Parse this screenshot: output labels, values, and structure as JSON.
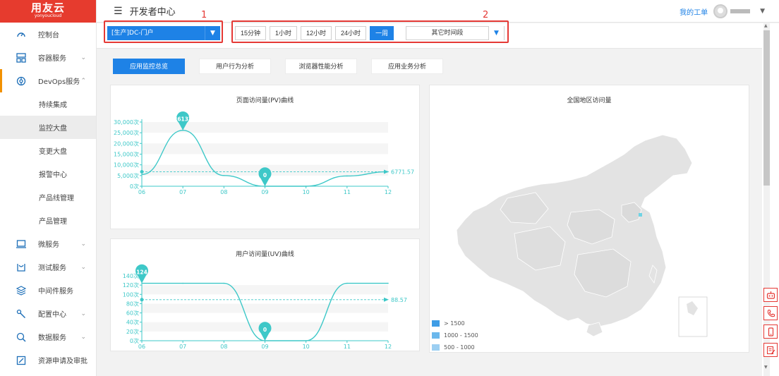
{
  "sidebar": {
    "logo": {
      "brand": "用友云",
      "sub": "yonyoucloud"
    },
    "items": [
      {
        "label": "控制台",
        "icon": "dashboard-icon"
      },
      {
        "label": "容器服务",
        "icon": "container-icon",
        "caret": "⌄"
      },
      {
        "label": "DevOps服务",
        "icon": "devops-icon",
        "caret": "⌃"
      },
      {
        "label": "持续集成"
      },
      {
        "label": "监控大盘"
      },
      {
        "label": "变更大盘"
      },
      {
        "label": "报警中心"
      },
      {
        "label": "产品线管理"
      },
      {
        "label": "产品管理"
      },
      {
        "label": "微服务",
        "icon": "microservice-icon",
        "caret": "⌄"
      },
      {
        "label": "测试服务",
        "icon": "test-icon",
        "caret": "⌄"
      },
      {
        "label": "中间件服务",
        "icon": "middleware-icon"
      },
      {
        "label": "配置中心",
        "icon": "config-icon",
        "caret": "⌄"
      },
      {
        "label": "数据服务",
        "icon": "data-icon",
        "caret": "⌄"
      },
      {
        "label": "资源申请及审批",
        "icon": "resource-icon"
      }
    ]
  },
  "header": {
    "title": "开发者中心",
    "work_order": "我的工单"
  },
  "filter": {
    "env_select": "[生产]DC-门户",
    "time_buttons": [
      "15分钟",
      "1小时",
      "12小时",
      "24小时",
      "一周"
    ],
    "active_time": "一周",
    "other_select": "其它时间段",
    "annotations": [
      "1",
      "2"
    ]
  },
  "tabs": [
    "应用监控总览",
    "用户行为分析",
    "浏览器性能分析",
    "应用业务分析"
  ],
  "colors": {
    "accent": "#1e82e6",
    "brand": "#e63b2e",
    "curve": "#3ec8c8",
    "active_marker": "#f29100",
    "annotation": "#e53935"
  },
  "map_panel": {
    "title": "全国地区访问量",
    "legend": [
      {
        "label": "> 1500",
        "color": "#3f9de6"
      },
      {
        "label": "1000 - 1500",
        "color": "#6cb8ec"
      },
      {
        "label": "500 - 1000",
        "color": "#9ccff2"
      }
    ]
  },
  "chart_data": [
    {
      "type": "line",
      "title": "页面访问量(PV)曲线",
      "categories": [
        "06",
        "07",
        "08",
        "09",
        "10",
        "11",
        "12"
      ],
      "values": [
        5500,
        26137,
        5000,
        0,
        0,
        4800,
        6771.57
      ],
      "y_ticks": [
        "0次",
        "5,000次",
        "10,000次",
        "15,000次",
        "20,000次",
        "25,000次",
        "30,000次"
      ],
      "ylim": [
        0,
        30000
      ],
      "max_marker": "26137",
      "min_marker": "0",
      "avg_line_label": "6771.57",
      "avg": 6771.57
    },
    {
      "type": "line",
      "title": "用户访问量(UV)曲线",
      "categories": [
        "06",
        "07",
        "08",
        "09",
        "10",
        "11",
        "12"
      ],
      "values": [
        124,
        124,
        124,
        0,
        0,
        124,
        124
      ],
      "y_ticks": [
        "0次",
        "20次",
        "40次",
        "60次",
        "80次",
        "100次",
        "120次",
        "140次"
      ],
      "ylim": [
        0,
        140
      ],
      "max_marker": "124",
      "min_marker": "0",
      "avg_line_label": "88.57",
      "avg": 88.57
    }
  ]
}
